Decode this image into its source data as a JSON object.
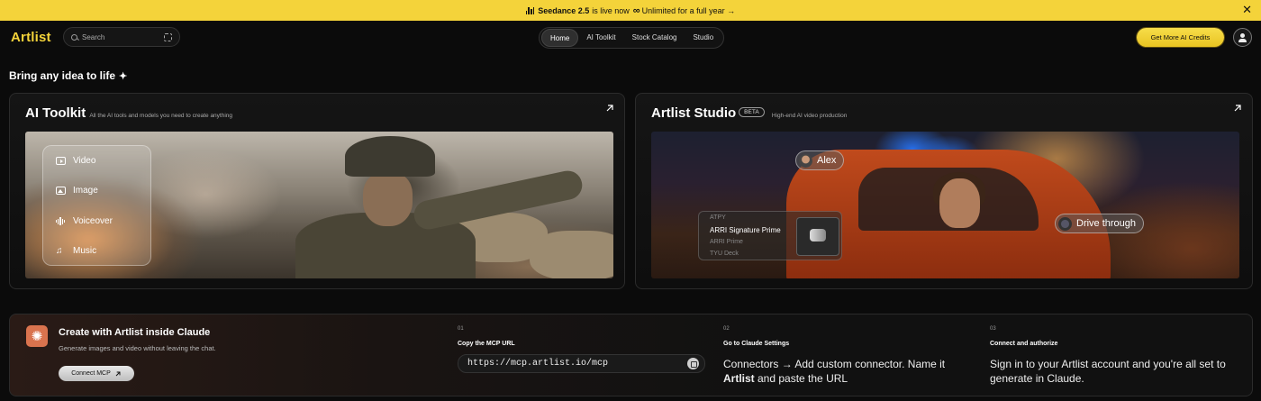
{
  "banner": {
    "brand": "Seedance 2.5",
    "text": "is live now",
    "promo": "Unlimited for a full year →"
  },
  "nav": {
    "logo": "Artlist",
    "search_placeholder": "Search",
    "tabs": [
      {
        "label": "Home",
        "active": true
      },
      {
        "label": "AI Toolkit",
        "active": false
      },
      {
        "label": "Stock Catalog",
        "active": false
      },
      {
        "label": "Studio",
        "active": false
      }
    ],
    "credits_label": "Get More AI Credits"
  },
  "headline": "Bring any idea to life",
  "toolkit": {
    "title": "AI Toolkit",
    "subtitle": "All the AI tools and models you need to create anything",
    "items": [
      {
        "label": "Video",
        "icon": "video-icon"
      },
      {
        "label": "Image",
        "icon": "image-icon"
      },
      {
        "label": "Voiceover",
        "icon": "voiceover-icon"
      },
      {
        "label": "Music",
        "icon": "music-icon"
      }
    ]
  },
  "studio": {
    "title": "Artlist Studio",
    "badge": "BETA",
    "subtitle": "High-end AI video production",
    "character_pill": "Alex",
    "action_pill": "Drive through",
    "lenses": [
      "ATPY",
      "ARRI Signature Prime",
      "ARRI Prime",
      "TYU Deck"
    ]
  },
  "claude": {
    "title": "Create with Artlist inside Claude",
    "subtitle": "Generate images and video without leaving the chat.",
    "button": "Connect MCP",
    "steps": [
      {
        "num": "01",
        "label": "Copy the MCP URL",
        "url": "https://mcp.artlist.io/mcp"
      },
      {
        "num": "02",
        "label": "Go to Claude Settings",
        "desc_pre": "Connectors → Add custom connector. Name it ",
        "desc_bold": "Artlist",
        "desc_post": " and paste the URL"
      },
      {
        "num": "03",
        "label": "Connect and authorize",
        "desc": "Sign in to your Artlist account and you're all set to generate in Claude."
      }
    ]
  },
  "colors": {
    "accent": "#f4d33a",
    "claude": "#d9734e",
    "background": "#0b0b0b"
  }
}
